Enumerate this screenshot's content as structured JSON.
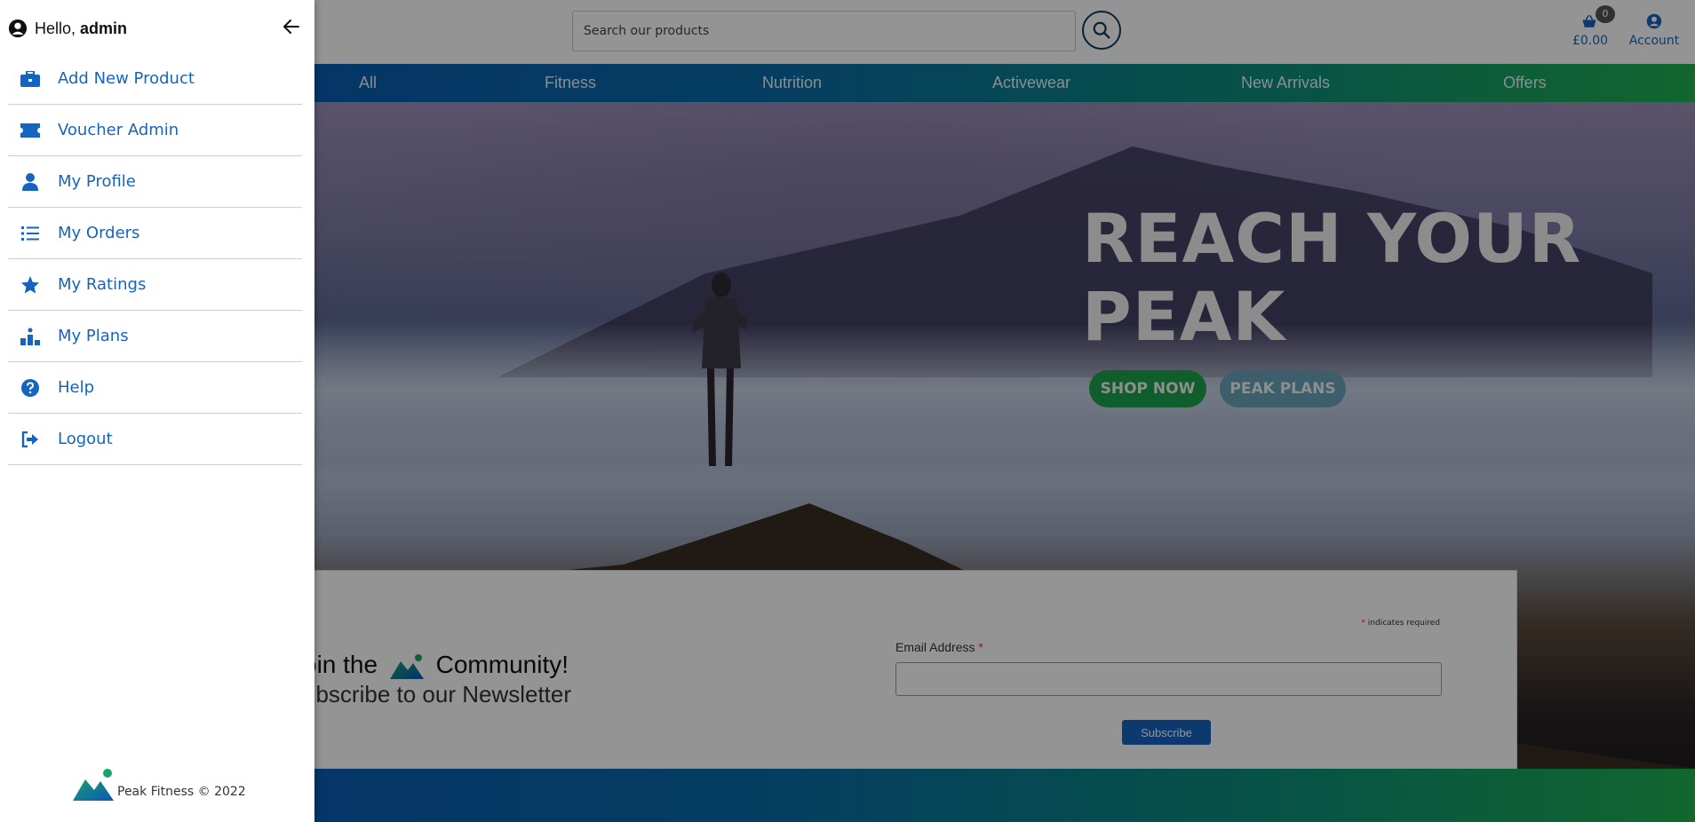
{
  "header": {
    "search_placeholder": "Search our products",
    "basket_count": "0",
    "basket_amount": "£0.00",
    "account_label": "Account"
  },
  "nav": {
    "items": [
      "All",
      "Fitness",
      "Nutrition",
      "Activewear",
      "New Arrivals",
      "Offers"
    ]
  },
  "hero": {
    "title_line1": "REACH YOUR",
    "title_line2": "PEAK",
    "shop_button": "SHOP NOW",
    "plans_button": "PEAK PLANS"
  },
  "newsletter": {
    "line1_prefix": "oin the",
    "line1_suffix": "Community!",
    "line2": "ubscribe to our Newsletter",
    "required_note": "indicates required",
    "email_label": "Email Address",
    "subscribe_button": "Subscribe"
  },
  "drawer": {
    "greeting": "Hello,",
    "username": "admin",
    "items": [
      {
        "label": "Add New Product",
        "icon": "toolbox-icon"
      },
      {
        "label": "Voucher Admin",
        "icon": "ticket-icon"
      },
      {
        "label": "My Profile",
        "icon": "user-icon"
      },
      {
        "label": "My Orders",
        "icon": "list-icon"
      },
      {
        "label": "My Ratings",
        "icon": "star-icon"
      },
      {
        "label": "My Plans",
        "icon": "podium-icon"
      },
      {
        "label": "Help",
        "icon": "question-circle-icon"
      },
      {
        "label": "Logout",
        "icon": "sign-out-icon"
      }
    ],
    "footer": "Peak Fitness © 2022"
  },
  "colors": {
    "brand_blue": "#1565c0",
    "brand_green": "#1aa34a",
    "plans_teal": "#6aa3b8"
  }
}
